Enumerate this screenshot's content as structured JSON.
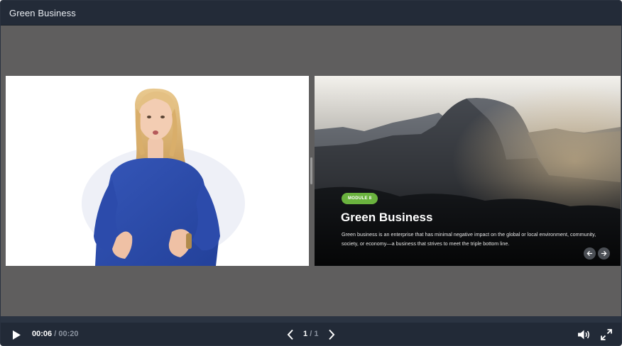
{
  "window": {
    "title": "Green Business"
  },
  "slide": {
    "badge": "MODULE 8",
    "title": "Green Business",
    "body": "Green business is an enterprise that has minimal negative impact on the global or local environment, community, society, or economy—a business that strives to meet the triple bottom line.",
    "prev_icon": "arrow-left-icon",
    "next_icon": "arrow-right-icon",
    "accent_color": "#6ab23e"
  },
  "player": {
    "current_time": "00:06",
    "separator": "/",
    "total_time": "00:20",
    "page_current": "1",
    "page_separator": "/",
    "page_total": "1",
    "play_icon": "play-icon",
    "prev_page_icon": "chevron-left-icon",
    "next_page_icon": "chevron-right-icon",
    "volume_icon": "volume-icon",
    "fullscreen_icon": "fullscreen-icon",
    "progress": 0.3
  }
}
